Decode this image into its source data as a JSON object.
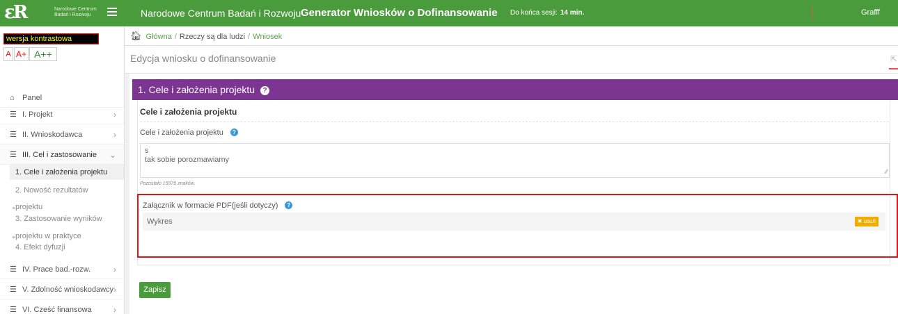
{
  "topbar": {
    "logo_mark": "εR",
    "logo_line1": "Narodowe Centrum",
    "logo_line2": "Badań i Rozwoju",
    "title": "Narodowe Centrum Badań i Rozwoju",
    "generator": "Generator Wniosków o Dofinansowanie",
    "session_label": "Do końca sesji:",
    "session_value": "14 min.",
    "user": "Grafff"
  },
  "accessibility": {
    "contrast_label": "wersja kontrastowa",
    "font_small": "A",
    "font_medium": "A+",
    "font_large": "A++"
  },
  "sidebar": {
    "items": [
      {
        "label": "Panel"
      },
      {
        "label": "I. Projekt"
      },
      {
        "label": "II. Wnioskodawca"
      },
      {
        "label": "III. Cel i zastosowanie"
      },
      {
        "label": "IV. Prace bad.-rozw."
      },
      {
        "label": "V. Zdolność wnioskodawcy"
      },
      {
        "label": "VI. Cześć finansowa"
      }
    ],
    "subitems": [
      {
        "label": "1. Cele i założenia projektu"
      },
      {
        "label_line1": "2. Nowość rezultatów",
        "label_line2": "projektu"
      },
      {
        "label_line1": "3. Zastosowanie wyników",
        "label_line2": "projektu w praktyce"
      },
      {
        "label": "4. Efekt dyfuzji"
      }
    ]
  },
  "breadcrumb": {
    "home": "Główna",
    "sep": "/",
    "middle": "Rzeczy są dla ludzi",
    "current": "Wniosek"
  },
  "page": {
    "title": "Edycja wniosku o dofinansowanie"
  },
  "section": {
    "header": "1. Cele i założenia projektu",
    "subtitle": "Cele i założenia projektu",
    "field_label": "Cele i założenia projektu",
    "field_value_line1": "s",
    "field_value_line2": "tak sobie porozmawiamy",
    "chars_left": "Pozostało 15976 znaków.",
    "attach_label": "Załącznik w formacie PDF(jeśli dotyczy)",
    "attach_file": "Wykres",
    "delete_label": "usuń",
    "save_label": "Zapisz"
  },
  "icons": {
    "home": "home-icon",
    "list": "list-icon",
    "help": "question-icon",
    "expand": "expand-icon",
    "close": "close-icon"
  },
  "colors": {
    "brand_green": "#4a9b3b",
    "section_purple": "#7c3591",
    "highlight_red": "#e3131b",
    "delete_orange": "#f0ad00",
    "help_blue": "#3a9ad9"
  }
}
